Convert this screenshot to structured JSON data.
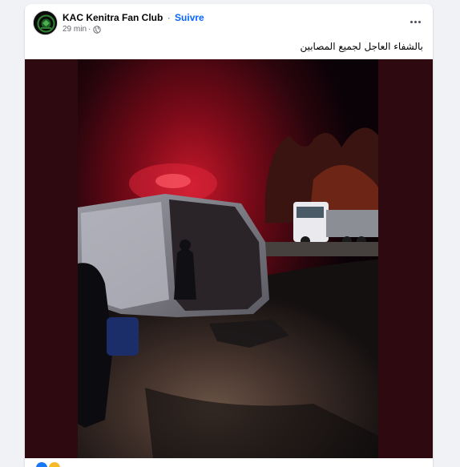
{
  "post": {
    "page_name": "KAC Kenitra Fan Club",
    "separator": "·",
    "follow_label": "Suivre",
    "timestamp": "29 min",
    "meta_separator": "·",
    "audience_icon": "globe-icon",
    "more_icon": "more-options-icon",
    "text": "بالشفاء العاجل لجميع المصابين"
  },
  "colors": {
    "page_background": "#f0f2f5",
    "card_background": "#ffffff",
    "follow_link": "#0866ff",
    "media_side_band": "#2e0a10",
    "avatar_ring": "#2e7d32"
  }
}
